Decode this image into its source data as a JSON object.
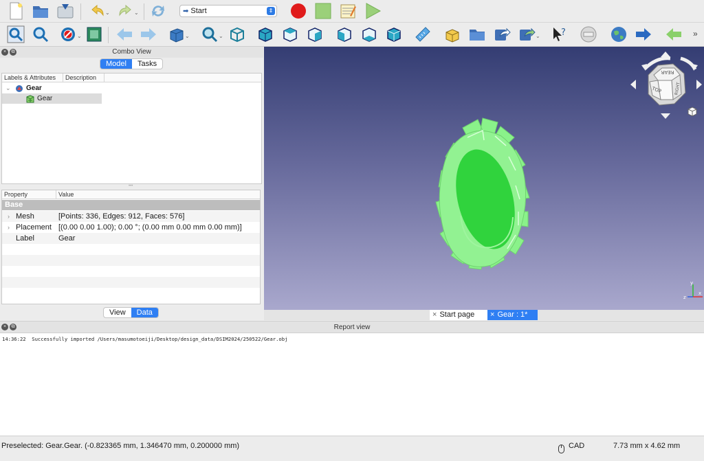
{
  "toolbar1": {
    "workbench": "Start"
  },
  "combo": {
    "title": "Combo View",
    "tabs": [
      {
        "label": "Model",
        "active": true
      },
      {
        "label": "Tasks",
        "active": false
      }
    ],
    "tree_headers": [
      "Labels & Attributes",
      "Description"
    ],
    "tree_items": [
      {
        "label": "Gear",
        "icon": "document-icon"
      },
      {
        "label": "Gear",
        "icon": "mesh-icon"
      }
    ],
    "prop_headers": [
      "Property",
      "Value"
    ],
    "group": "Base",
    "properties": [
      {
        "key": "Mesh",
        "value": "[Points: 336, Edges: 912, Faces: 576]"
      },
      {
        "key": "Placement",
        "value": "[(0.00 0.00 1.00); 0.00 °; (0.00 mm  0.00 mm  0.00 mm)]"
      },
      {
        "key": "Label",
        "value": "Gear"
      }
    ],
    "bottom_tabs": [
      {
        "label": "View",
        "active": false
      },
      {
        "label": "Data",
        "active": true
      }
    ]
  },
  "view3d": {
    "navcube": {
      "front": "TOP",
      "right": "RIGHT",
      "rear": "REAR"
    },
    "axes": {
      "x": "x",
      "y": "y",
      "z": "z"
    }
  },
  "doc_tabs": [
    {
      "label": "Start page",
      "active": false
    },
    {
      "label": "Gear : 1*",
      "active": true
    }
  ],
  "report": {
    "title": "Report view",
    "lines": [
      "14:36:22  Successfully imported /Users/masumotoeiji/Desktop/design_data/DSIM2024/250522/Gear.obj"
    ]
  },
  "status": {
    "message": "Preselected: Gear.Gear. (-0.823365 mm, 1.346470 mm, 0.200000 mm)",
    "nav_style": "CAD",
    "dimensions": "7.73 mm x 4.62 mm"
  },
  "colors": {
    "accent": "#2f7ff3",
    "gear": "#8af28a",
    "gear_inner": "#2fd23a"
  }
}
